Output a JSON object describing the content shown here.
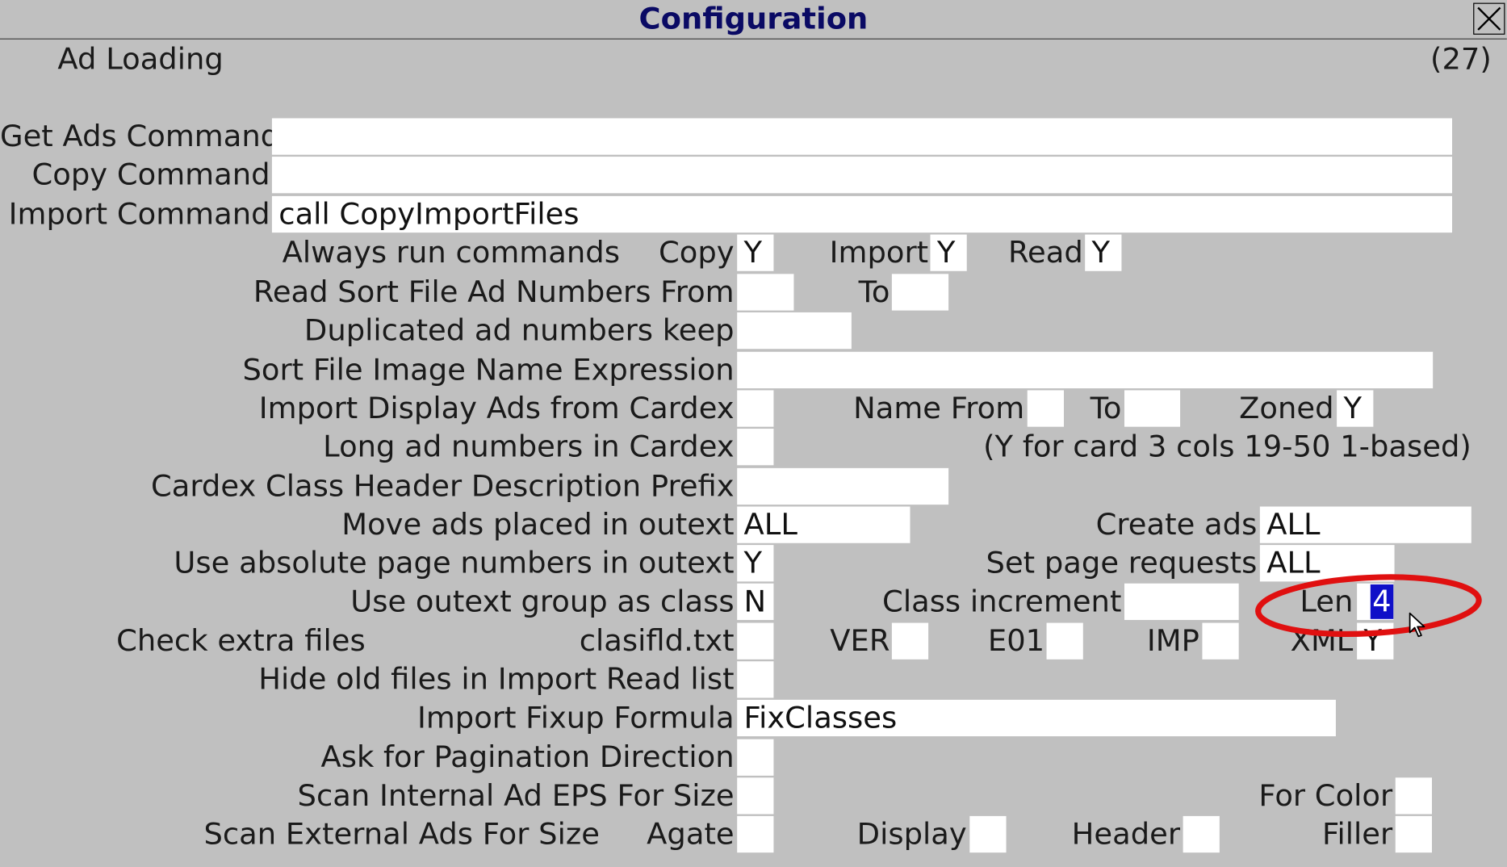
{
  "window": {
    "title": "Configuration"
  },
  "header": {
    "section": "Ad Loading",
    "screen_number": "(27)"
  },
  "fields": {
    "get_ads_command": {
      "label": "Get Ads Command",
      "value": ""
    },
    "copy_command": {
      "label": "Copy Command",
      "value": ""
    },
    "import_command": {
      "label": "Import Command",
      "value": "call CopyImportFiles"
    },
    "always_run": {
      "label": "Always run commands",
      "copy_label": "Copy",
      "copy_value": "Y",
      "import_label": "Import",
      "import_value": "Y",
      "read_label": "Read",
      "read_value": "Y"
    },
    "read_sort": {
      "label": "Read Sort File Ad Numbers From",
      "from_value": "",
      "to_label": "To",
      "to_value": ""
    },
    "dup_keep": {
      "label": "Duplicated ad numbers keep",
      "value": ""
    },
    "sort_image": {
      "label": "Sort File Image Name Expression",
      "value": ""
    },
    "import_display": {
      "label": "Import Display Ads from Cardex",
      "value": "",
      "name_from_label": "Name From",
      "name_from_value": "",
      "to_label": "To",
      "to_value": "",
      "zoned_label": "Zoned",
      "zoned_value": "Y"
    },
    "long_ad": {
      "label": "Long ad numbers in Cardex",
      "value": "",
      "note": "(Y for card 3 cols 19-50 1-based)"
    },
    "cardex_prefix": {
      "label": "Cardex Class Header Description Prefix",
      "value": ""
    },
    "move_ads": {
      "label": "Move ads placed in outext",
      "value": "ALL",
      "create_label": "Create ads",
      "create_value": "ALL"
    },
    "abs_page": {
      "label": "Use absolute page numbers in outext",
      "value": "Y",
      "set_page_label": "Set page requests",
      "set_page_value": "ALL"
    },
    "outext_group": {
      "label": "Use outext group as class",
      "value": "N",
      "class_inc_label": "Class increment",
      "class_inc_value": "",
      "len_label": "Len",
      "len_value": "4"
    },
    "check_extra": {
      "label": "Check extra files",
      "clasifld_label": "clasifld.txt",
      "clasifld_value": "",
      "ver_label": "VER",
      "ver_value": "",
      "e01_label": "E01",
      "e01_value": "",
      "imp_label": "IMP",
      "imp_value": "",
      "xml_label": "XML",
      "xml_value": "Y"
    },
    "hide_old": {
      "label": "Hide old files in Import Read list",
      "value": ""
    },
    "fixup": {
      "label": "Import Fixup Formula",
      "value": "FixClasses"
    },
    "pagination": {
      "label": "Ask for Pagination Direction",
      "value": ""
    },
    "scan_internal": {
      "label": "Scan Internal Ad EPS For Size",
      "value": "",
      "for_color_label": "For Color",
      "for_color_value": ""
    },
    "scan_external": {
      "label": "Scan External Ads For Size",
      "agate_label": "Agate",
      "agate_value": "",
      "display_label": "Display",
      "display_value": "",
      "header_label": "Header",
      "header_value": "",
      "filler_label": "Filler",
      "filler_value": ""
    }
  },
  "icons": {
    "close": "close-x-icon",
    "cursor": "mouse-pointer-icon"
  },
  "colors": {
    "background": "#c0c0c0",
    "title_text": "#0a0a64",
    "selection": "#1010c8",
    "annotation": "#e01010"
  }
}
